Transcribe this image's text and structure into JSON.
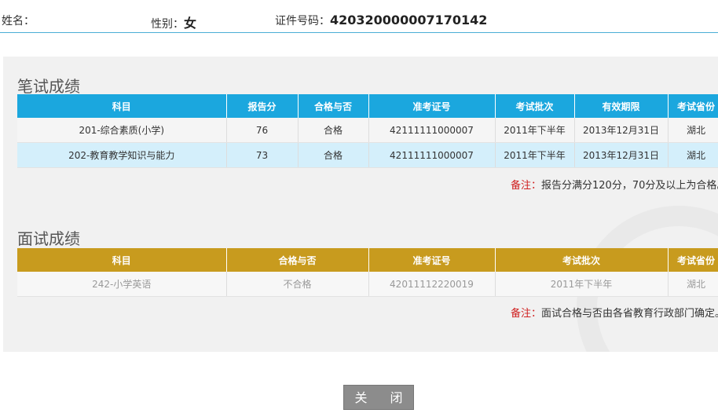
{
  "header": {
    "name_label": "姓名：",
    "name_value": "",
    "gender_label": "性别：",
    "gender_value": "女",
    "id_label": "证件号码：",
    "id_value": "420320000007170142"
  },
  "written": {
    "title": "笔试成绩",
    "columns": [
      "科目",
      "报告分",
      "合格与否",
      "准考证号",
      "考试批次",
      "有效期限",
      "考试省份"
    ],
    "rows": [
      {
        "subject": "201-综合素质(小学)",
        "score": "76",
        "pass": "合格",
        "exam_no": "42111111000007",
        "batch": "2011年下半年",
        "valid": "2013年12月31日",
        "province": "湖北"
      },
      {
        "subject": "202-教育教学知识与能力",
        "score": "73",
        "pass": "合格",
        "exam_no": "42111111000007",
        "batch": "2011年下半年",
        "valid": "2013年12月31日",
        "province": "湖北"
      }
    ],
    "note_label": "备注：",
    "note_text": "报告分满分120分，70分及以上为合格。"
  },
  "interview": {
    "title": "面试成绩",
    "columns": [
      "科目",
      "合格与否",
      "准考证号",
      "考试批次",
      "考试省份"
    ],
    "rows": [
      {
        "subject": "242-小学英语",
        "pass": "不合格",
        "exam_no": "42011112220019",
        "batch": "2011年下半年",
        "province": "湖北"
      }
    ],
    "note_label": "备注：",
    "note_text": "面试合格与否由各省教育行政部门确定。"
  },
  "close_button": "关 闭"
}
